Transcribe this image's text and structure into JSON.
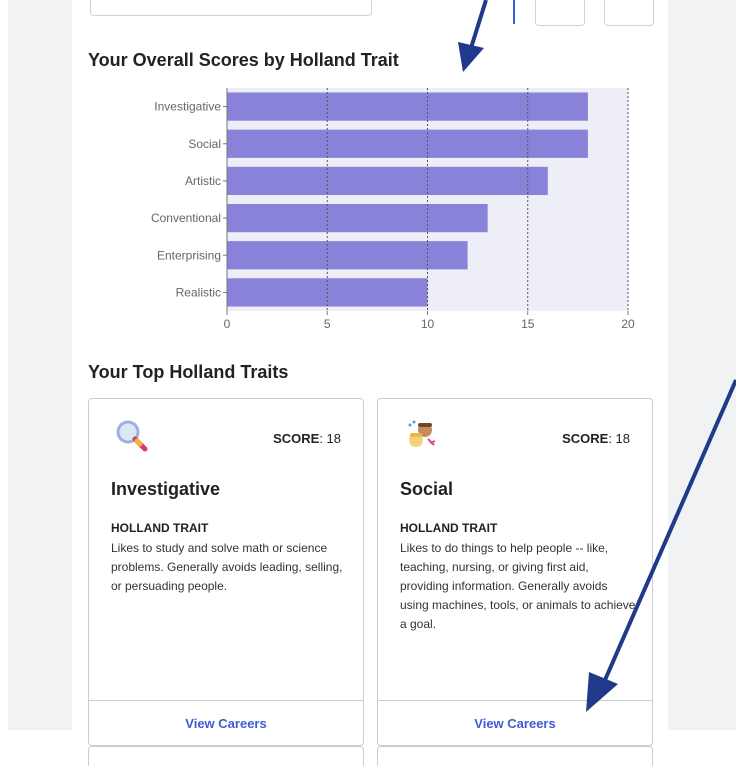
{
  "chart_section": {
    "title": "Your Overall Scores by Holland Trait"
  },
  "chart_data": {
    "type": "bar",
    "orientation": "horizontal",
    "title": "Your Overall Scores by Holland Trait",
    "categories": [
      "Investigative",
      "Social",
      "Artistic",
      "Conventional",
      "Enterprising",
      "Realistic"
    ],
    "values": [
      18,
      18,
      16,
      13,
      12,
      10
    ],
    "xlim": [
      0,
      20
    ],
    "xticks": [
      "0",
      "5",
      "10",
      "15",
      "20"
    ],
    "grid": "vertical dashed",
    "bar_color": "#8883d9",
    "plot_background": "#eeeef8"
  },
  "traits_section": {
    "title": "Your Top Holland Traits"
  },
  "cards": [
    {
      "icon": "magnifying-glass-icon",
      "score_label": "SCORE",
      "score_value": ": 18",
      "title": "Investigative",
      "label": "HOLLAND TRAIT",
      "description": "Likes to study and solve math or science problems. Generally avoids leading, selling, or persuading people.",
      "action": "View Careers"
    },
    {
      "icon": "people-icon",
      "score_label": "SCORE",
      "score_value": ": 18",
      "title": "Social",
      "label": "HOLLAND TRAIT",
      "description": "Likes to do things to help people -- like, teaching, nursing, or giving first aid, providing information. Generally avoids using machines, tools, or animals to achieve a goal.",
      "action": "View Careers"
    }
  ],
  "colors": {
    "accent": "#3c5bd6",
    "annotation_arrow": "#1f3a8a",
    "bar": "#8883d9"
  }
}
